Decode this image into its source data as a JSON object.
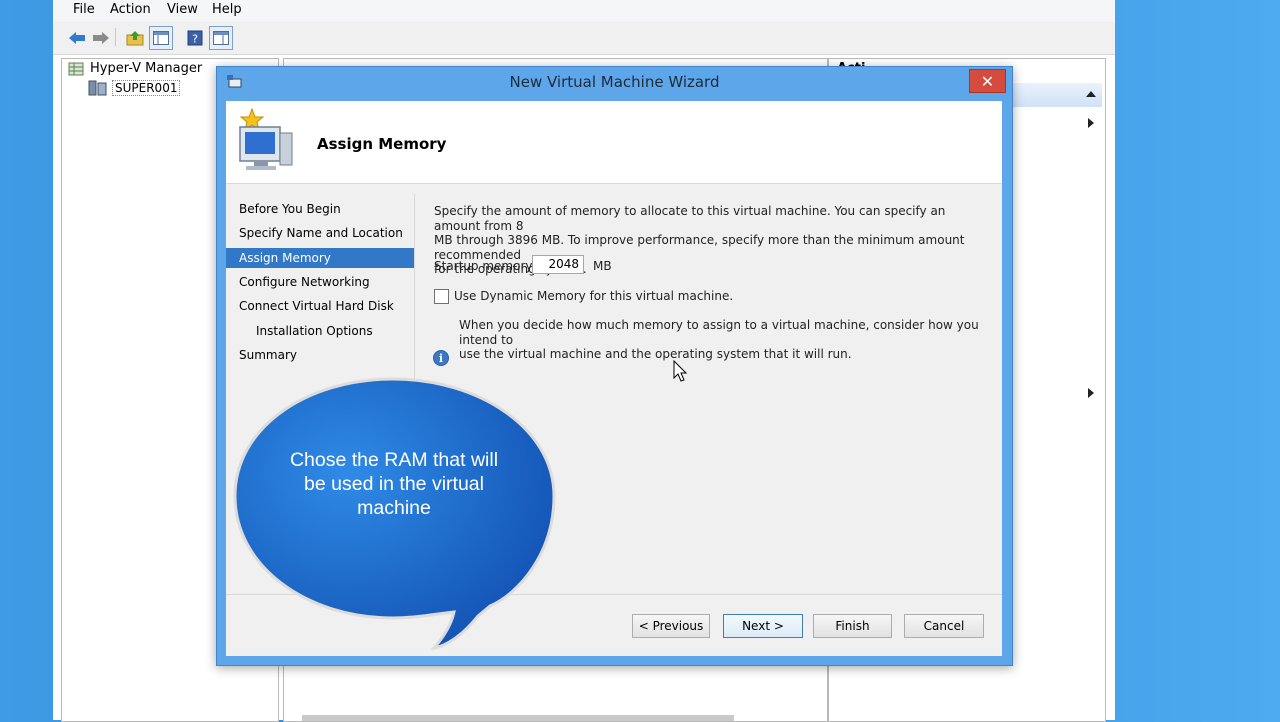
{
  "mmc": {
    "menu": [
      "File",
      "Action",
      "View",
      "Help"
    ],
    "tree": {
      "root": "Hyper-V Manager",
      "server": "SUPER001"
    },
    "actions_header": "Acti"
  },
  "wizard": {
    "title": "New Virtual Machine Wizard",
    "close_glyph": "✕",
    "heading": "Assign Memory",
    "steps": [
      "Before You Begin",
      "Specify Name and Location",
      "Assign Memory",
      "Configure Networking",
      "Connect Virtual Hard Disk",
      "Installation Options",
      "Summary"
    ],
    "active_step": "Assign Memory",
    "description_lines": [
      "Specify the amount of memory to allocate to this virtual machine. You can specify an amount from 8",
      "MB through 3896 MB. To improve performance, specify more than the minimum amount recommended",
      "for the operating system."
    ],
    "startup_memory_label": "Startup memory:",
    "startup_memory_value": "2048",
    "startup_memory_unit": "MB",
    "dynamic_memory_label": "Use Dynamic Memory for this virtual machine.",
    "dynamic_memory_checked": false,
    "info_lines": [
      "When you decide how much memory to assign to a virtual machine, consider how you intend to",
      "use the virtual machine and the operating system that it will run."
    ],
    "buttons": {
      "previous": "< Previous",
      "next": "Next >",
      "finish": "Finish",
      "cancel": "Cancel"
    }
  },
  "callout": {
    "lines": [
      "Chose the RAM that will",
      "be used in the virtual",
      "machine"
    ]
  },
  "colors": {
    "accent": "#3278c8",
    "bubble": "#1f6fcf",
    "desktop": "#3f9be4"
  }
}
